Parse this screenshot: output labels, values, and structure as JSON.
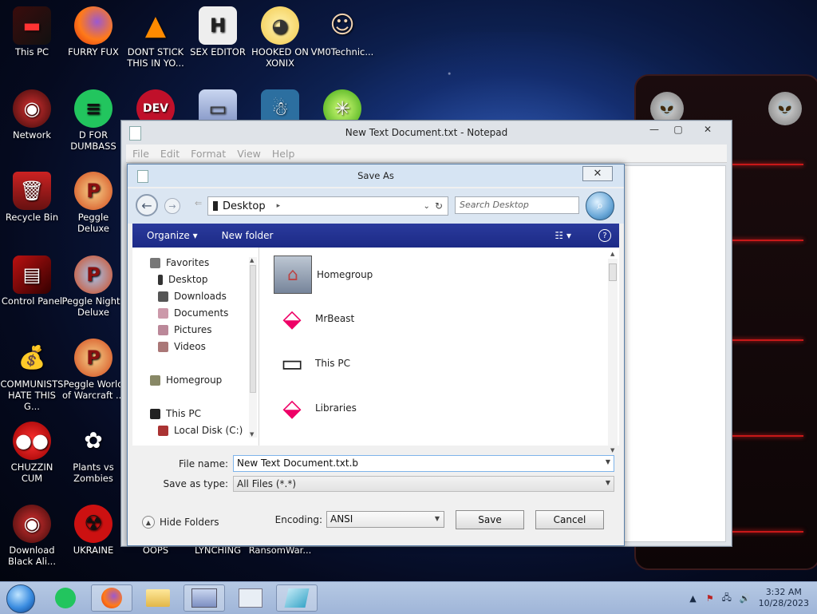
{
  "desktop": {
    "icons": [
      {
        "label": "This PC"
      },
      {
        "label": "FURRY FUX"
      },
      {
        "label": "DONT STICK THIS IN YO..."
      },
      {
        "label": "SEX EDITOR"
      },
      {
        "label": "HOOKED ON XONIX"
      },
      {
        "label": "VM0Technic..."
      },
      {
        "label": "Network"
      },
      {
        "label": "D FOR DUMBASS"
      },
      {
        "label": "Recycle Bin"
      },
      {
        "label": "Peggle Deluxe"
      },
      {
        "label": "Control Panel"
      },
      {
        "label": "Peggle Nights Deluxe"
      },
      {
        "label": "COMMUNISTS HATE THIS G..."
      },
      {
        "label": "Peggle World of Warcraft ..."
      },
      {
        "label": "CHUZZIN CUM"
      },
      {
        "label": "Plants vs Zombies"
      },
      {
        "label": "Download Black Ali..."
      },
      {
        "label": "UKRAINE"
      },
      {
        "label": "OOPS"
      },
      {
        "label": "LYNCHING"
      },
      {
        "label": "RansomWar..."
      }
    ],
    "dev_icon_text": "DEV"
  },
  "notepad": {
    "title": "New Text Document.txt - Notepad",
    "menu": [
      "File",
      "Edit",
      "Format",
      "View",
      "Help"
    ]
  },
  "save_dialog": {
    "title": "Save As",
    "address": "Desktop",
    "search_placeholder": "Search Desktop",
    "toolbar": {
      "organize": "Organize ▾",
      "new_folder": "New folder"
    },
    "nav": {
      "favorites": "Favorites",
      "desktop": "Desktop",
      "downloads": "Downloads",
      "documents": "Documents",
      "pictures": "Pictures",
      "videos": "Videos",
      "homegroup": "Homegroup",
      "this_pc": "This PC",
      "local_disk": "Local Disk (C:)"
    },
    "files": [
      "Homegroup",
      "MrBeast",
      "This PC",
      "Libraries"
    ],
    "file_name_label": "File name:",
    "file_name_value": "New Text Document.txt.b",
    "save_as_type_label": "Save as type:",
    "save_as_type_value": "All Files  (*.*)",
    "hide_folders": "Hide Folders",
    "encoding_label": "Encoding:",
    "encoding_value": "ANSI",
    "save_button": "Save",
    "cancel_button": "Cancel"
  },
  "taskbar": {
    "time": "3:32 AM",
    "date": "10/28/2023"
  },
  "colors": {
    "dialog_toolbar": "#1c2a86",
    "widget_red": "#e02020",
    "taskbar": "#a9bedd"
  }
}
